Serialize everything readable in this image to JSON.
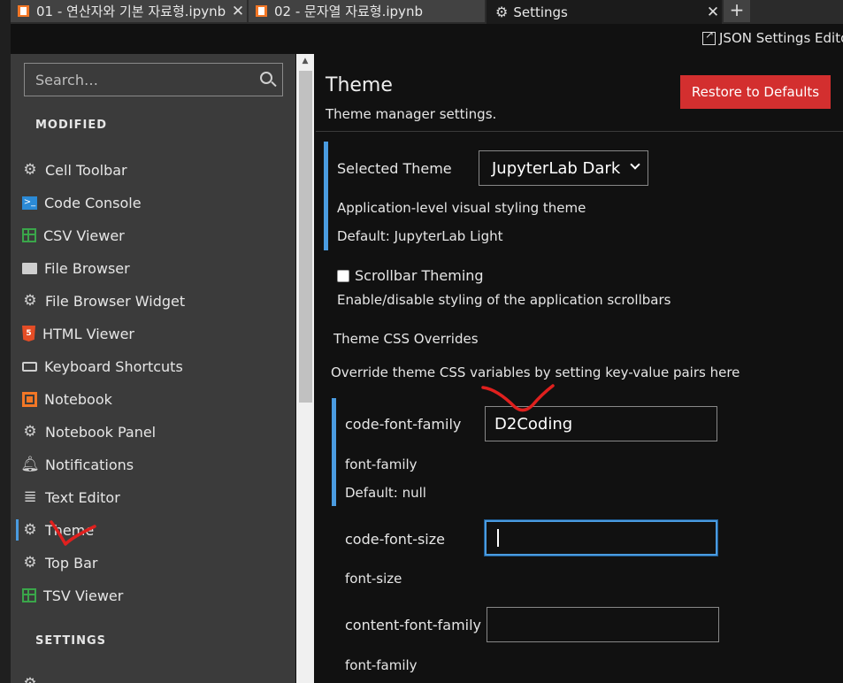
{
  "tabs": [
    {
      "label": "01 - 연산자와 기본 자료형.ipynb",
      "close": "✕"
    },
    {
      "label": "02 - 문자열 자료형.ipynb",
      "close": "✕"
    },
    {
      "label": "Settings",
      "close": "✕"
    }
  ],
  "new_tab": "+",
  "toolbar": {
    "json_settings": "JSON Settings Editor"
  },
  "sidebar": {
    "search_placeholder": "Search…",
    "modified_title": "MODIFIED",
    "settings_title": "SETTINGS",
    "items": [
      {
        "label": "Cell Toolbar",
        "icon": "gear-icon"
      },
      {
        "label": "Code Console",
        "icon": "console-icon"
      },
      {
        "label": "CSV Viewer",
        "icon": "grid-icon"
      },
      {
        "label": "File Browser",
        "icon": "folder-icon"
      },
      {
        "label": "File Browser Widget",
        "icon": "gear-icon"
      },
      {
        "label": "HTML Viewer",
        "icon": "html5-icon"
      },
      {
        "label": "Keyboard Shortcuts",
        "icon": "keyboard-icon"
      },
      {
        "label": "Notebook",
        "icon": "notebook-icon"
      },
      {
        "label": "Notebook Panel",
        "icon": "gear-icon"
      },
      {
        "label": "Notifications",
        "icon": "bell-icon"
      },
      {
        "label": "Text Editor",
        "icon": "text-lines-icon"
      },
      {
        "label": "Theme",
        "icon": "gear-icon",
        "selected": true
      },
      {
        "label": "Top Bar",
        "icon": "gear-icon"
      },
      {
        "label": "TSV Viewer",
        "icon": "grid-icon"
      }
    ]
  },
  "main": {
    "title": "Theme",
    "subtitle": "Theme manager settings.",
    "restore_label": "Restore to Defaults",
    "selected_theme": {
      "label": "Selected Theme",
      "value": "JupyterLab Dark",
      "description": "Application-level visual styling theme",
      "default": "Default: JupyterLab Light"
    },
    "scrollbar_theming": {
      "label": "Scrollbar Theming",
      "checked": false,
      "description": "Enable/disable styling of the application scrollbars"
    },
    "overrides": {
      "title": "Theme CSS Overrides",
      "description": "Override theme CSS variables by setting key-value pairs here",
      "fields": [
        {
          "key": "code-font-family",
          "value": "D2Coding",
          "type": "font-family",
          "default": "Default: null"
        },
        {
          "key": "code-font-size",
          "value": "",
          "type": "font-size"
        },
        {
          "key": "content-font-family",
          "value": "",
          "type": "font-family"
        }
      ]
    }
  },
  "colors": {
    "accent": "#4a9be0",
    "danger": "#d32f2f",
    "annotation": "#e0201e"
  }
}
